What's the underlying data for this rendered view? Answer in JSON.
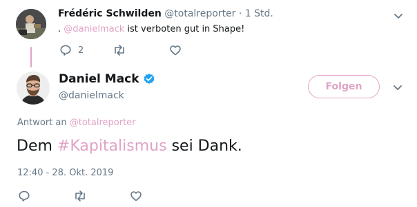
{
  "reply_tweet": {
    "author_name": "Frédéric Schwilden",
    "handle": "@totalreporter",
    "separator": "·",
    "time": "1 Std.",
    "text_prefix": ". ",
    "mention": "@danielmack",
    "text_rest": " ist verboten gut in Shape!",
    "reply_count": "2"
  },
  "main_tweet": {
    "author_name": "Daniel Mack",
    "handle": "@danielmack",
    "follow_label": "Folgen",
    "reply_to_label": "Antwort an",
    "reply_to_handle": "@totalreporter",
    "text_before": "Dem ",
    "hashtag": "#Kapitalismus",
    "text_after": " sei Dank.",
    "timestamp": "12:40 - 28. Okt. 2019"
  },
  "colors": {
    "accent": "#e0a3c6",
    "muted": "#657786",
    "text": "#14171a",
    "verified": "#1da1f2"
  }
}
